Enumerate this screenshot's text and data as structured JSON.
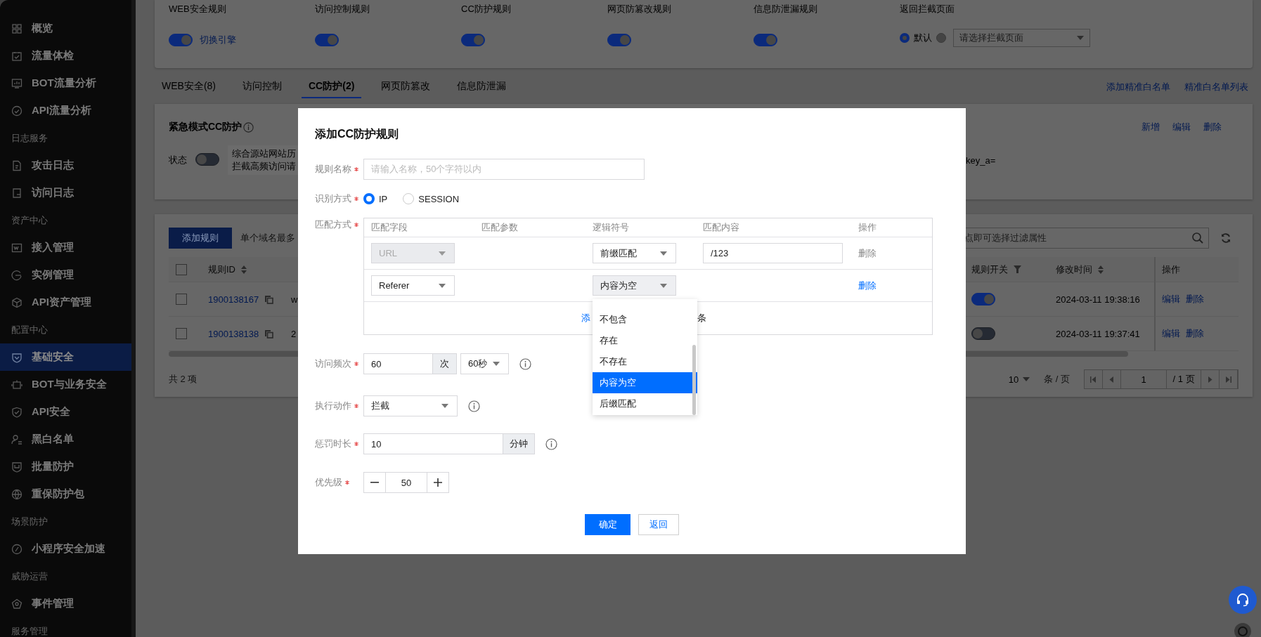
{
  "sidebar": {
    "items": [
      {
        "kind": "item",
        "label": "概览",
        "selected": false
      },
      {
        "kind": "item",
        "label": "流量体检",
        "selected": false
      },
      {
        "kind": "item",
        "label": "BOT流量分析",
        "selected": false
      },
      {
        "kind": "item",
        "label": "API流量分析",
        "selected": false
      },
      {
        "kind": "section",
        "label": "日志服务"
      },
      {
        "kind": "item",
        "label": "攻击日志",
        "selected": false
      },
      {
        "kind": "item",
        "label": "访问日志",
        "selected": false
      },
      {
        "kind": "section",
        "label": "资产中心"
      },
      {
        "kind": "item",
        "label": "接入管理",
        "selected": false
      },
      {
        "kind": "item",
        "label": "实例管理",
        "selected": false
      },
      {
        "kind": "item",
        "label": "API资产管理",
        "selected": false
      },
      {
        "kind": "section",
        "label": "配置中心"
      },
      {
        "kind": "item",
        "label": "基础安全",
        "selected": true
      },
      {
        "kind": "item",
        "label": "BOT与业务安全",
        "selected": false
      },
      {
        "kind": "item",
        "label": "API安全",
        "selected": false
      },
      {
        "kind": "item",
        "label": "黑白名单",
        "selected": false
      },
      {
        "kind": "item",
        "label": "批量防护",
        "selected": false
      },
      {
        "kind": "item",
        "label": "重保防护包",
        "selected": false
      },
      {
        "kind": "section",
        "label": "场景防护"
      },
      {
        "kind": "item",
        "label": "小程序安全加速",
        "selected": false
      },
      {
        "kind": "section",
        "label": "威胁运营"
      },
      {
        "kind": "item",
        "label": "事件管理",
        "selected": false
      },
      {
        "kind": "section",
        "label": "服务管理"
      }
    ]
  },
  "rule_switches": [
    {
      "label": "WEB安全规则",
      "on": true,
      "link": "切换引擎"
    },
    {
      "label": "访问控制规则",
      "on": true
    },
    {
      "label": "CC防护规则",
      "on": true
    },
    {
      "label": "网页防篡改规则",
      "on": true
    },
    {
      "label": "信息防泄漏规则",
      "on": true
    }
  ],
  "block_page": {
    "label": "返回拦截页面",
    "options": [
      {
        "label": "默认",
        "selected": true
      },
      {
        "selected": false,
        "placeholder": "请选择拦截页面"
      }
    ]
  },
  "tabs": [
    {
      "label": "WEB安全(8)",
      "selected": false
    },
    {
      "label": "访问控制",
      "selected": false
    },
    {
      "label": "CC防护(2)",
      "selected": true
    },
    {
      "label": "网页防篡改",
      "selected": false
    },
    {
      "label": "信息防泄漏",
      "selected": false
    }
  ],
  "tab_links": [
    "添加精准白名单",
    "精准白名单列表"
  ],
  "emergency": {
    "title": "紧急模式CC防护",
    "status_label": "状态",
    "on": false,
    "description_lines": [
      "综合源站网站历",
      "拦截高频访问请"
    ],
    "trailing_text": "key_a=",
    "actions": [
      "新增",
      "编辑",
      "删除"
    ]
  },
  "rules_table": {
    "add_button": "添加规则",
    "hint": "单个域名最多",
    "select_all_checked": false,
    "search": {
      "placeholder": "点即可选择过滤属性"
    },
    "columns": [
      {
        "label": "规则ID",
        "kind": "sortable"
      },
      {
        "label": "规则开关",
        "kind": "filterable"
      },
      {
        "label": "修改时间",
        "kind": "sortable"
      },
      {
        "label": "操作",
        "kind": "plain"
      }
    ],
    "rows": [
      {
        "checked": false,
        "id": "1900138167",
        "column_3": "w",
        "enabled": true,
        "modified": "2024-03-11 19:38:16",
        "actions": [
          "编辑",
          "删除"
        ]
      },
      {
        "checked": false,
        "id": "1900138138",
        "column_3": "2",
        "enabled": false,
        "modified": "2024-03-11 19:37:41",
        "actions": [
          "编辑",
          "删除"
        ]
      }
    ],
    "total": "共 2 项",
    "pagination": {
      "page_size": "10",
      "page_size_unit": "条 / 页",
      "page": "1",
      "page_total": "/ 1 页"
    }
  },
  "dialog": {
    "title": "添加CC防护规则",
    "fields": [
      {
        "kind": "text",
        "label": "规则名称",
        "required": true,
        "placeholder": "请输入名称，50个字符以内"
      },
      {
        "kind": "radio",
        "label": "识别方式",
        "required": true,
        "options": [
          {
            "label": "IP",
            "selected": true
          },
          {
            "label": "SESSION",
            "selected": false
          }
        ]
      },
      {
        "kind": "match_table",
        "label": "匹配方式",
        "required": true,
        "columns": [
          "匹配字段",
          "匹配参数",
          "逻辑符号",
          "匹配内容",
          "操作"
        ],
        "rows": [
          {
            "field": "URL",
            "field_disabled": true,
            "operator": "前缀匹配",
            "operator_open": false,
            "content": "/123",
            "delete": "删除",
            "delete_disabled": true
          },
          {
            "field": "Referer",
            "field_disabled": false,
            "operator": "内容为空",
            "operator_open": true,
            "delete": "删除",
            "delete_disabled": false,
            "operator_options": [
              {
                "label": "不包含",
                "selected": false
              },
              {
                "label": "存在",
                "selected": false
              },
              {
                "label": "不存在",
                "selected": false
              },
              {
                "label": "内容为空",
                "selected": true
              },
              {
                "label": "后缀匹配",
                "selected": false
              }
            ]
          }
        ],
        "add_row_texts": [
          "添",
          "条"
        ]
      },
      {
        "kind": "number_unit",
        "label": "访问频次",
        "required": true,
        "value": "60",
        "unit": "次",
        "period": "60秒",
        "info": true
      },
      {
        "kind": "select",
        "label": "执行动作",
        "required": true,
        "value": "拦截",
        "info": true
      },
      {
        "kind": "number_unit",
        "label": "惩罚时长",
        "required": true,
        "value": "10",
        "unit": "分钟",
        "info": true
      },
      {
        "kind": "stepper",
        "label": "优先级",
        "required": true,
        "value": "50"
      }
    ],
    "buttons": [
      {
        "label": "确定",
        "kind": "primary"
      },
      {
        "label": "返回",
        "kind": "secondary"
      }
    ]
  }
}
